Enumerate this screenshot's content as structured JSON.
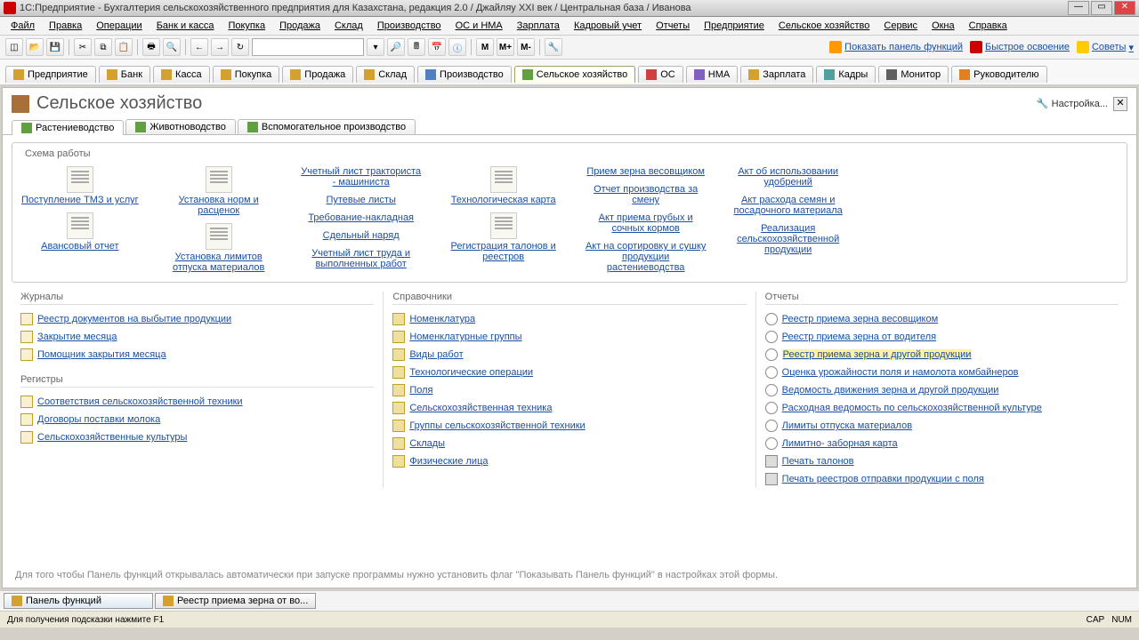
{
  "title": "1С:Предприятие - Бухгалтерия сельскохозяйственного предприятия для Казахстана, редакция 2.0 / Джайляу XXI век / Центральная база / Иванова",
  "menu": [
    "Файл",
    "Правка",
    "Операции",
    "Банк и касса",
    "Покупка",
    "Продажа",
    "Склад",
    "Производство",
    "ОС и НМА",
    "Зарплата",
    "Кадровый учет",
    "Отчеты",
    "Предприятие",
    "Сельское хозяйство",
    "Сервис",
    "Окна",
    "Справка"
  ],
  "tool_links": {
    "panel": "Показать панель функций",
    "quick": "Быстрое освоение",
    "tips": "Советы"
  },
  "section_tabs": [
    {
      "id": "enterprise",
      "label": "Предприятие"
    },
    {
      "id": "bank",
      "label": "Банк"
    },
    {
      "id": "cash",
      "label": "Касса"
    },
    {
      "id": "purchase",
      "label": "Покупка"
    },
    {
      "id": "sale",
      "label": "Продажа"
    },
    {
      "id": "warehouse",
      "label": "Склад"
    },
    {
      "id": "production",
      "label": "Производство"
    },
    {
      "id": "agriculture",
      "label": "Сельское хозяйство",
      "active": true
    },
    {
      "id": "os",
      "label": "ОС"
    },
    {
      "id": "nma",
      "label": "НМА"
    },
    {
      "id": "salary",
      "label": "Зарплата"
    },
    {
      "id": "hr",
      "label": "Кадры"
    },
    {
      "id": "monitor",
      "label": "Монитор"
    },
    {
      "id": "manager",
      "label": "Руководителю"
    }
  ],
  "page_title": "Сельское хозяйство",
  "settings_label": "Настройка...",
  "subtabs": [
    {
      "id": "crop",
      "label": "Растениеводство",
      "active": true
    },
    {
      "id": "livestock",
      "label": "Животноводство"
    },
    {
      "id": "aux",
      "label": "Вспомогательное производство"
    }
  ],
  "schema_title": "Схема работы",
  "schema": {
    "c1": [
      {
        "label": "Поступление ТМЗ и услуг",
        "icon": true
      },
      {
        "label": "Авансовый отчет",
        "icon": true
      }
    ],
    "c2": [
      {
        "label": "Установка норм и расценок",
        "icon": true
      },
      {
        "label": "Установка лимитов отпуска материалов",
        "icon": true
      }
    ],
    "c3": [
      {
        "label": "Учетный лист тракториста - машиниста"
      },
      {
        "label": "Путевые листы"
      },
      {
        "label": "Требование-накладная"
      },
      {
        "label": "Сдельный наряд"
      },
      {
        "label": "Учетный лист труда и выполненных работ"
      }
    ],
    "c4": [
      {
        "label": "Технологическая карта",
        "icon": true
      },
      {
        "label": "Регистрация талонов и реестров",
        "icon": true
      }
    ],
    "c5": [
      {
        "label": "Прием зерна весовщиком"
      },
      {
        "label": "Отчет производства за смену"
      },
      {
        "label": "Акт приема грубых и сочных кормов"
      },
      {
        "label": "Акт на сортировку и сушку продукции растениеводства"
      }
    ],
    "c6": [
      {
        "label": "Акт об использовании удобрений"
      },
      {
        "label": "Акт расхода семян и посадочного материала"
      },
      {
        "label": "Реализация сельскохозяйственной продукции"
      }
    ]
  },
  "journals_title": "Журналы",
  "journals": [
    "Реестр документов на выбытие продукции",
    "Закрытие месяца",
    "Помощник закрытия месяца"
  ],
  "registers_title": "Регистры",
  "registers": [
    "Соответствия сельскохозяйственной техники",
    "Договоры поставки молока",
    "Сельскохозяйственные культуры"
  ],
  "catalogs_title": "Справочники",
  "catalogs": [
    "Номенклатура",
    "Номенклатурные группы",
    "Виды работ",
    "Технологические операции",
    "Поля",
    "Сельскохозяйственная техника",
    "Группы сельскохозяйственной техники",
    "Склады",
    "Физические лица"
  ],
  "reports_title": "Отчеты",
  "reports": [
    {
      "label": "Реестр приема зерна весовщиком",
      "t": "rep"
    },
    {
      "label": "Реестр приема зерна от водителя",
      "t": "rep"
    },
    {
      "label": "Реестр приема зерна и другой продукции",
      "t": "rep",
      "hl": true
    },
    {
      "label": "Оценка урожайности поля и намолота комбайнеров",
      "t": "rep"
    },
    {
      "label": "Ведомость движения зерна и другой продукции",
      "t": "rep"
    },
    {
      "label": "Расходная ведомость по сельскохозяйственной культуре",
      "t": "rep"
    },
    {
      "label": "Лимиты отпуска материалов",
      "t": "rep"
    },
    {
      "label": "Лимитно- заборная карта",
      "t": "rep"
    },
    {
      "label": "Печать талонов",
      "t": "print"
    },
    {
      "label": "Печать реестров отправки продукции с поля",
      "t": "print"
    }
  ],
  "hint": "Для того чтобы Панель функций открывалась автоматически при запуске программы нужно установить флаг \"Показывать Панель функций\" в настройках этой формы.",
  "bottom_tabs": [
    {
      "label": "Панель функций",
      "active": true
    },
    {
      "label": "Реестр приема зерна от во..."
    }
  ],
  "status": "Для получения подсказки нажмите F1",
  "status_right": [
    "CAP",
    "NUM"
  ]
}
